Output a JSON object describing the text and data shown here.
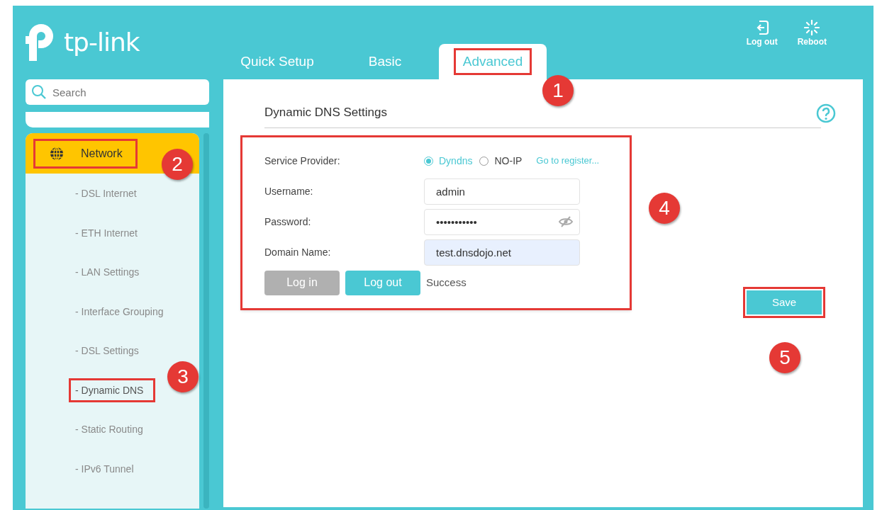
{
  "logo": {
    "text": "tp-link"
  },
  "tabs": [
    {
      "label": "Quick Setup",
      "selected": false,
      "highlighted": false
    },
    {
      "label": "Basic",
      "selected": false,
      "highlighted": false
    },
    {
      "label": "Advanced",
      "selected": true,
      "highlighted": true
    }
  ],
  "header_actions": [
    {
      "label": "Log out",
      "kind": "logout"
    },
    {
      "label": "Reboot",
      "kind": "reboot"
    }
  ],
  "sidebar": {
    "search": {
      "placeholder": "Search"
    },
    "section": {
      "label": "Network",
      "highlighted": true
    },
    "items": [
      {
        "label": "- DSL Internet",
        "highlighted": false
      },
      {
        "label": "- ETH Internet",
        "highlighted": false
      },
      {
        "label": "- LAN Settings",
        "highlighted": false
      },
      {
        "label": "- Interface Grouping",
        "highlighted": false
      },
      {
        "label": "- DSL Settings",
        "highlighted": false
      },
      {
        "label": "- Dynamic DNS",
        "highlighted": true
      },
      {
        "label": "- Static Routing",
        "highlighted": false
      },
      {
        "label": "- IPv6 Tunnel",
        "highlighted": false
      }
    ]
  },
  "content": {
    "title": "Dynamic DNS Settings",
    "form": {
      "highlighted": true,
      "service_provider": {
        "label": "Service Provider:",
        "options": [
          {
            "label": "Dyndns",
            "selected": true
          },
          {
            "label": "NO-IP",
            "selected": false
          }
        ],
        "link": "Go to register..."
      },
      "fields": [
        {
          "label": "Username:",
          "value": "admin",
          "kind": "text",
          "autofilled": false
        },
        {
          "label": "Password:",
          "value": "•••••••••••",
          "kind": "password",
          "autofilled": false
        },
        {
          "label": "Domain Name:",
          "value": "test.dnsdojo.net",
          "kind": "text",
          "autofilled": true
        }
      ],
      "buttons": [
        {
          "label": "Log in",
          "disabled": true
        },
        {
          "label": "Log out",
          "disabled": false
        }
      ],
      "status": "Success"
    },
    "save_button": {
      "label": "Save",
      "highlighted": true
    }
  },
  "markers": [
    {
      "label": "1"
    },
    {
      "label": "2"
    },
    {
      "label": "3"
    },
    {
      "label": "4"
    },
    {
      "label": "5"
    }
  ]
}
